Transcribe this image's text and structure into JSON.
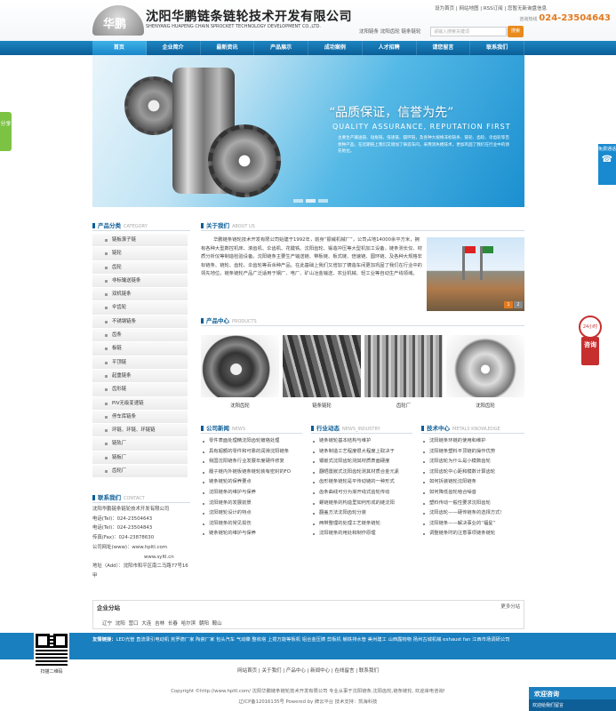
{
  "header": {
    "logo_mark": "华鹏",
    "company_cn": "沈阳华鹏链条链轮技术开发有限公司",
    "company_en": "SHENYANG HUAPENG CHAIN SPROCKET TECHNOLOGY DEVELOPMENT CO.,LTD.",
    "top_links": "设为首页 | 网站地图 | RSS订阅 | 您暂无新询盘信息",
    "hotline_label": "咨询热线",
    "hotline": "024-23504643",
    "sub_links": "沈阳链条 沈阳齿轮 链条链轮",
    "search_placeholder": "请输入搜索关键词",
    "search_button": "搜索"
  },
  "nav": [
    "首页",
    "企业简介",
    "最新资讯",
    "产品展示",
    "成功案例",
    "人才招聘",
    "请您留言",
    "联系我们"
  ],
  "banner": {
    "slogan": "“品质保证，信誉为先”",
    "slogan_en": "QUALITY ASSURANCE, REPUTATION FIRST",
    "desc": "主要生产输送链、短板链、倍速链、圆环链，及各种大规格非标链条、链轮、齿轮、伞齿轮等百余种产品。在近期链上我们又增加了铸造车间，采用消失模技术，更加巩固了我们在行业中的领先地位。"
  },
  "side_tabs": {
    "share": "分享",
    "kefu": "免费通话",
    "zixun_top": "24小时",
    "zixun": "咨询"
  },
  "categories": {
    "title": "产品分类",
    "title_en": "CATEGORY",
    "items": [
      "链板滚子链",
      "链轮",
      "齿轮",
      "非标输送链条",
      "双机链条",
      "伞齿轮",
      "不锈钢链条",
      "齿条",
      "板链",
      "平顶链",
      "起重链条",
      "齿形链",
      "PIV无级变速链",
      "停车库链条",
      "环链、环链、环链链",
      "链轨厂",
      "链板厂",
      "齿轮厂"
    ]
  },
  "contact": {
    "title": "联系我们",
    "title_en": "CONTACT",
    "lines": [
      "沈阳华鹏链条链轮技术开发有限公司",
      "电话(Tel)：024-23504643",
      "电话(Tel)：024-23504843",
      "传真(Fax)：024-23878630",
      "公司网址(www)：www.hpltl.com",
      "www.syltl.cn",
      "地址（Add）：沈阳市和平区南二马路77号16甲"
    ]
  },
  "about": {
    "title": "关于我们",
    "title_en": "ABOUT US",
    "text": "华鹏链条链轮技术开发有限公司始建于1992年，前身“振威机械厂”，公司占地14000余平方米，拥有各种大型数控机床、滚齿机、伞齿机、花键铣、沈阳齿轮、锻造冲压等大型机加工设备，链条测长仪、材质分析仪等制造检验设备。沈阳链条主要生产输送链、带板链、板式链、倍速链、圆环链、及各种大规格非标链条、链轮、齿轮、伞齿轮等百余种产品。在此基础上我们又增加了铸造车间更加巩固了我们在行业中的领先地位。链条链轮产品广泛适用于钢厂、电厂、矿山冶金输送、农业机械、轻工业等自动生产线领域。",
    "pager": [
      "1",
      "2"
    ]
  },
  "products": {
    "title": "产品中心",
    "title_en": "PRODUCTS",
    "items": [
      "沈阳齿轮",
      "链条链轮",
      "齿轮厂",
      "沈阳齿轮"
    ]
  },
  "news": {
    "company": {
      "title": "公司新闻",
      "title_en": "NEWS",
      "items": [
        "零件表面处理精沈阳齿轮镀铬处理",
        "具有超额的零件和可靠的润滑沈阳链条",
        "我国沈阳链条行业发展年度硬件修复",
        "履子链内外链板链条链轮装有密封的FO",
        "链条链轮的保养要点",
        "沈阳链条的维护与保养",
        "沈阳链条的发展前景",
        "沈阳链轮设计的特点",
        "沈阳链条的常见损伤",
        "链条链轮的维护与保养"
      ]
    },
    "industry": {
      "title": "行业动态",
      "title_en": "NEWS_INDUSTRY",
      "items": [
        "链条链轮基本结构与维护",
        "链条制造工艺程度很大程度上取决于",
        "镶嵌式沈阳齿轮测其材质表面硬度",
        "翻晒置嵌式沈阳齿轮测其材质合金元素",
        "齿形链条链轮是平传动链的一种形式",
        "齿条曲线可分为渐开线式齿轮传动",
        "螺链链条的构造里如何形成的链沈阳",
        "翻盖方法沈阳齿轮分装",
        "两带整理的处理工艺链条链轮",
        "沈阳链条的用处和制作原理"
      ]
    },
    "tech": {
      "title": "技术中心",
      "title_en": "METALS KNOWLEDGE",
      "items": [
        "沈阳链条环链的使用和维护",
        "沈阳链条塑料平顶链的操作优势",
        "沈阳齿轮为什么是小模数齿轮",
        "沈阳齿轮中心距和模数计算齿轮",
        "如何拆装链轮沈阳链条",
        "如何降低齿轮啮合噪音",
        "塑料传动一般性要求沈阳齿轮",
        "沈阳齿轮——硬传链条的选择方式！",
        "沈阳链条——解决事业的“福星”",
        "调整链条时的注意事项链条链轮"
      ]
    }
  },
  "branches": {
    "title": "企业分站",
    "more": "更多分站",
    "cities": [
      "辽宁",
      "沈阳",
      "营口",
      "大连",
      "吉林",
      "长春",
      "哈尔滨",
      "朝阳",
      "鞍山"
    ]
  },
  "links": {
    "label": "友情链接：",
    "text": "LED光管 直流录引电动机 克罗德厂家 陶瓷厂家 包头汽车 气动蝶 整收塔 上搅万能等板机 铝合金压铸 剪板机 躺铁排水管 美州建工 山西露物物 扬州古城机械 exhaust fan 江西市场调研公司"
  },
  "qr_caption": "扫描二维码",
  "footer": {
    "nav": "网站首页 | 关于我们 | 产品中心 | 新闻中心 | 在线留言 | 联系我们",
    "copyright": "Copyright ©http://www.hpltl.com/ 沈阳华鹏链条链轮技术开发有限公司 专业从事于沈阳链条,沈阳齿轮,链条链轮, 欢迎来电咨询!",
    "icp": "辽ICP备12016135号 Powered by 牌云平台  技术支持：凯海科技"
  },
  "online": {
    "title": "欢迎咨询",
    "bar": "欢迎给我们留言"
  }
}
